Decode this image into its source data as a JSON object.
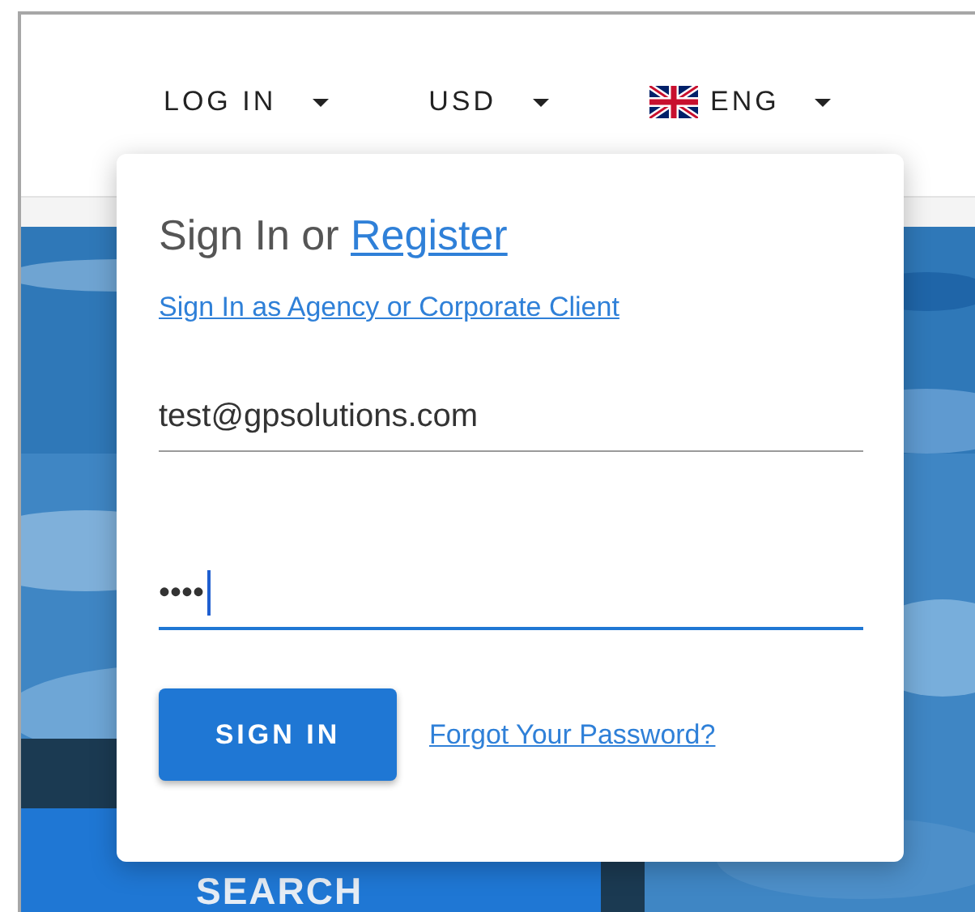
{
  "header": {
    "menus": [
      {
        "label": "LOG IN",
        "kind": "text"
      },
      {
        "label": "USD",
        "kind": "text"
      },
      {
        "label": "ENG",
        "kind": "flag"
      }
    ]
  },
  "signin_popup": {
    "title": "Sign In or",
    "register_link": "Register",
    "agency_link": "Sign In as Agency or Corporate Client",
    "fields": [
      {
        "kind": "email",
        "value": "test@gpsolutions.com",
        "focused": false
      },
      {
        "kind": "password",
        "value": "••••",
        "focused": true
      }
    ],
    "sign_in_button": "SIGN IN",
    "forgot_link": "Forgot Your Password?"
  },
  "search_button": "SEARCH"
}
